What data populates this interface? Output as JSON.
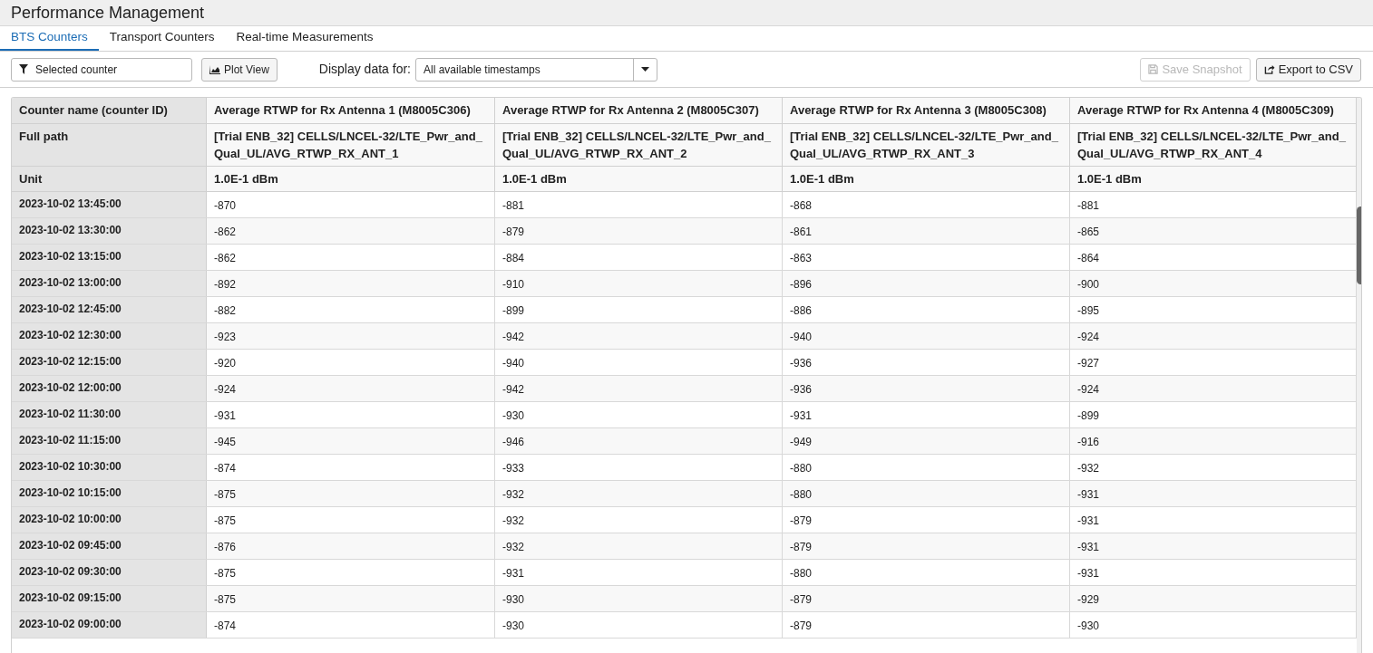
{
  "window": {
    "title": "Performance Management"
  },
  "tabs": [
    {
      "label": "BTS Counters",
      "selected": true
    },
    {
      "label": "Transport Counters",
      "selected": false
    },
    {
      "label": "Real-time Measurements",
      "selected": false
    }
  ],
  "toolbar": {
    "filter": {
      "value": "Selected counter"
    },
    "plot_button": "Plot View",
    "display_label": "Display data for:",
    "display_select": {
      "value": "All available timestamps"
    },
    "save_button": {
      "label": "Save Snapshot",
      "disabled": true
    },
    "export_button": {
      "label": "Export to CSV",
      "disabled": false
    }
  },
  "table": {
    "header_rows": [
      {
        "label": "Counter name (counter ID)",
        "cells": [
          "Average RTWP for Rx Antenna 1 (M8005C306)",
          "Average RTWP for Rx Antenna 2 (M8005C307)",
          "Average RTWP for Rx Antenna 3 (M8005C308)",
          "Average RTWP for Rx Antenna 4 (M8005C309)"
        ]
      },
      {
        "label": "Full path",
        "cells": [
          "[Trial ENB_32] CELLS/LNCEL-32/LTE_Pwr_and_Qual_UL/AVG_RTWP_RX_ANT_1",
          "[Trial ENB_32] CELLS/LNCEL-32/LTE_Pwr_and_Qual_UL/AVG_RTWP_RX_ANT_2",
          "[Trial ENB_32] CELLS/LNCEL-32/LTE_Pwr_and_Qual_UL/AVG_RTWP_RX_ANT_3",
          "[Trial ENB_32] CELLS/LNCEL-32/LTE_Pwr_and_Qual_UL/AVG_RTWP_RX_ANT_4"
        ]
      },
      {
        "label": "Unit",
        "cells": [
          "1.0E-1 dBm",
          "1.0E-1 dBm",
          "1.0E-1 dBm",
          "1.0E-1 dBm"
        ]
      }
    ],
    "rows": [
      {
        "time": "2023-10-02 13:45:00",
        "values": [
          "-870",
          "-881",
          "-868",
          "-881"
        ]
      },
      {
        "time": "2023-10-02 13:30:00",
        "values": [
          "-862",
          "-879",
          "-861",
          "-865"
        ]
      },
      {
        "time": "2023-10-02 13:15:00",
        "values": [
          "-862",
          "-884",
          "-863",
          "-864"
        ]
      },
      {
        "time": "2023-10-02 13:00:00",
        "values": [
          "-892",
          "-910",
          "-896",
          "-900"
        ]
      },
      {
        "time": "2023-10-02 12:45:00",
        "values": [
          "-882",
          "-899",
          "-886",
          "-895"
        ]
      },
      {
        "time": "2023-10-02 12:30:00",
        "values": [
          "-923",
          "-942",
          "-940",
          "-924"
        ]
      },
      {
        "time": "2023-10-02 12:15:00",
        "values": [
          "-920",
          "-940",
          "-936",
          "-927"
        ]
      },
      {
        "time": "2023-10-02 12:00:00",
        "values": [
          "-924",
          "-942",
          "-936",
          "-924"
        ]
      },
      {
        "time": "2023-10-02 11:30:00",
        "values": [
          "-931",
          "-930",
          "-931",
          "-899"
        ]
      },
      {
        "time": "2023-10-02 11:15:00",
        "values": [
          "-945",
          "-946",
          "-949",
          "-916"
        ]
      },
      {
        "time": "2023-10-02 10:30:00",
        "values": [
          "-874",
          "-933",
          "-880",
          "-932"
        ]
      },
      {
        "time": "2023-10-02 10:15:00",
        "values": [
          "-875",
          "-932",
          "-880",
          "-931"
        ]
      },
      {
        "time": "2023-10-02 10:00:00",
        "values": [
          "-875",
          "-932",
          "-879",
          "-931"
        ]
      },
      {
        "time": "2023-10-02 09:45:00",
        "values": [
          "-876",
          "-932",
          "-879",
          "-931"
        ]
      },
      {
        "time": "2023-10-02 09:30:00",
        "values": [
          "-875",
          "-931",
          "-880",
          "-931"
        ]
      },
      {
        "time": "2023-10-02 09:15:00",
        "values": [
          "-875",
          "-930",
          "-879",
          "-929"
        ]
      },
      {
        "time": "2023-10-02 09:00:00",
        "values": [
          "-874",
          "-930",
          "-879",
          "-930"
        ]
      }
    ]
  }
}
